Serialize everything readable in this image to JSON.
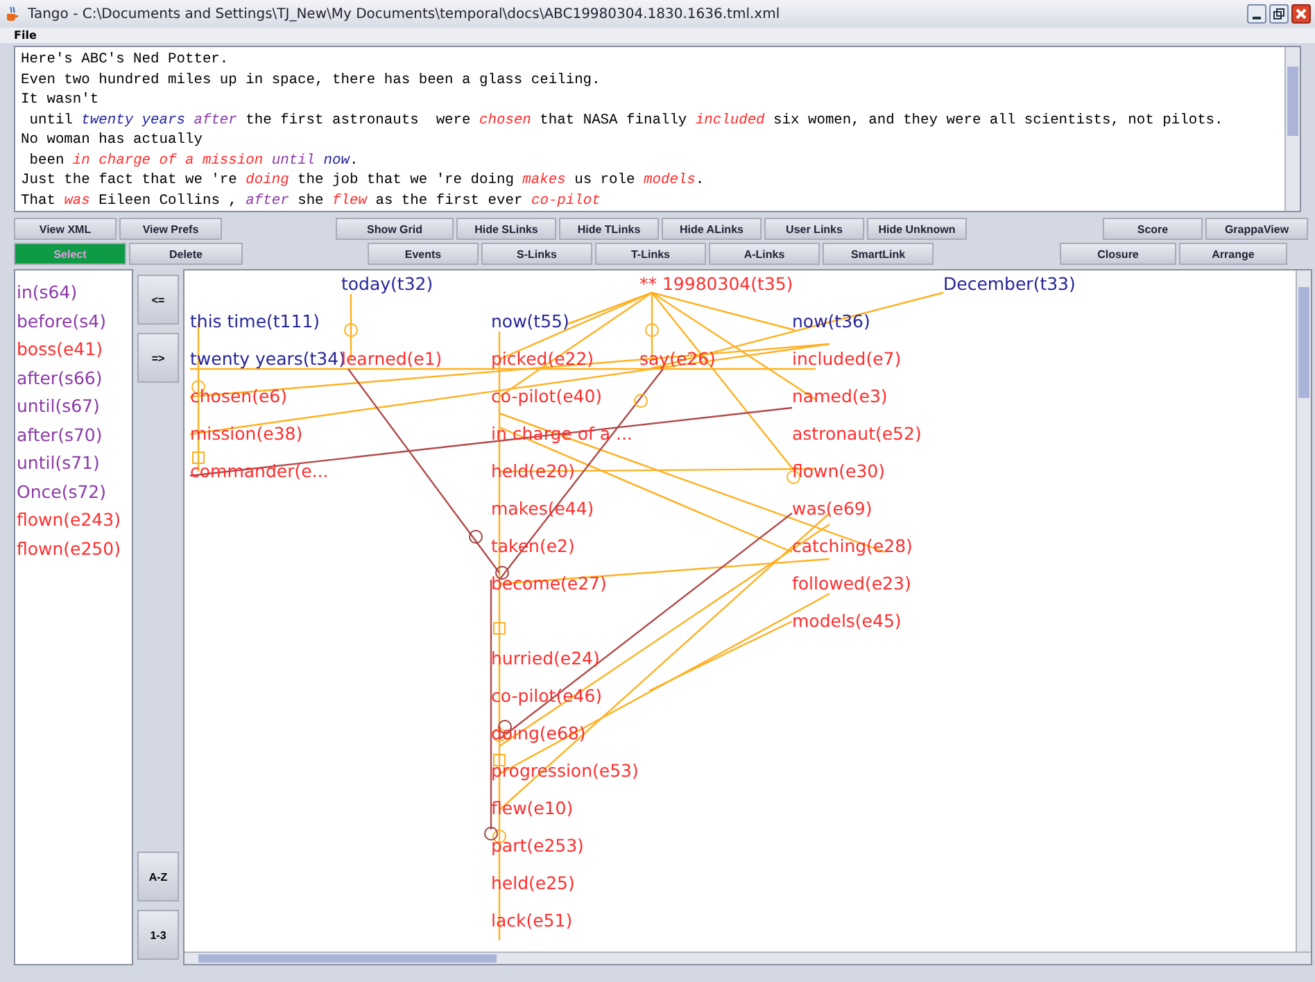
{
  "window": {
    "title": "Tango - C:\\Documents and Settings\\TJ_New\\My Documents\\temporal\\docs\\ABC19980304.1830.1636.tml.xml"
  },
  "menu": [
    "File"
  ],
  "document_lines": [
    [
      {
        "text": "Here's ABC's Ned Potter.",
        "kind": "plain"
      }
    ],
    [
      {
        "text": "Even two hundred miles up in space, there has been a glass ceiling.",
        "kind": "plain"
      }
    ],
    [
      {
        "text": "It wasn't",
        "kind": "plain"
      }
    ],
    [
      {
        "text": " until ",
        "kind": "plain"
      },
      {
        "text": "twenty years ",
        "kind": "timex"
      },
      {
        "text": "after",
        "kind": "signal"
      },
      {
        "text": " the first astronauts  were ",
        "kind": "plain"
      },
      {
        "text": "chosen",
        "kind": "event"
      },
      {
        "text": " that NASA finally ",
        "kind": "plain"
      },
      {
        "text": "included",
        "kind": "event"
      },
      {
        "text": " six women, and they were all scientists, not pilots.",
        "kind": "plain"
      }
    ],
    [
      {
        "text": "No woman has actually",
        "kind": "plain"
      }
    ],
    [
      {
        "text": " been ",
        "kind": "plain"
      },
      {
        "text": "in charge of a mission ",
        "kind": "event"
      },
      {
        "text": "until ",
        "kind": "signal"
      },
      {
        "text": "now",
        "kind": "timex"
      },
      {
        "text": ".",
        "kind": "plain"
      }
    ],
    [
      {
        "text": "Just the fact that we 're ",
        "kind": "plain"
      },
      {
        "text": "doing",
        "kind": "event"
      },
      {
        "text": " the job that we 're doing ",
        "kind": "plain"
      },
      {
        "text": "makes",
        "kind": "event"
      },
      {
        "text": " us role ",
        "kind": "plain"
      },
      {
        "text": "models",
        "kind": "event"
      },
      {
        "text": ".",
        "kind": "plain"
      }
    ],
    [
      {
        "text": "That ",
        "kind": "plain"
      },
      {
        "text": "was",
        "kind": "event"
      },
      {
        "text": " Eileen Collins , ",
        "kind": "plain"
      },
      {
        "text": "after",
        "kind": "signal"
      },
      {
        "text": " she ",
        "kind": "plain"
      },
      {
        "text": "flew",
        "kind": "event"
      },
      {
        "text": " as the first ever ",
        "kind": "plain"
      },
      {
        "text": "co-pilot",
        "kind": "event"
      }
    ]
  ],
  "toolbar_rows": [
    [
      {
        "label": "View XML",
        "selected": false
      },
      {
        "label": "View Prefs",
        "selected": false
      },
      {
        "label": "Show Grid",
        "selected": false
      },
      {
        "label": "Hide SLinks",
        "selected": false
      },
      {
        "label": "Hide TLinks",
        "selected": false
      },
      {
        "label": "Hide ALinks",
        "selected": false
      },
      {
        "label": "User Links",
        "selected": false
      },
      {
        "label": "Hide Unknown",
        "selected": false
      },
      {
        "label": "Score",
        "selected": false
      },
      {
        "label": "GrappaView",
        "selected": false
      }
    ],
    [
      {
        "label": "Select",
        "selected": true
      },
      {
        "label": "Delete",
        "selected": false
      },
      {
        "label": "Events",
        "selected": false
      },
      {
        "label": "S-Links",
        "selected": false
      },
      {
        "label": "T-Links",
        "selected": false
      },
      {
        "label": "A-Links",
        "selected": false
      },
      {
        "label": "SmartLink",
        "selected": false
      },
      {
        "label": "Closure",
        "selected": false
      },
      {
        "label": "Arrange",
        "selected": false
      }
    ]
  ],
  "unplaced": [
    {
      "label": "in(s64)",
      "kind": "signal"
    },
    {
      "label": "before(s4)",
      "kind": "signal"
    },
    {
      "label": "boss(e41)",
      "kind": "event"
    },
    {
      "label": "after(s66)",
      "kind": "signal"
    },
    {
      "label": "until(s67)",
      "kind": "signal"
    },
    {
      "label": "after(s70)",
      "kind": "signal"
    },
    {
      "label": "until(s71)",
      "kind": "signal"
    },
    {
      "label": "Once(s72)",
      "kind": "signal"
    },
    {
      "label": "flown(e243)",
      "kind": "event"
    },
    {
      "label": "flown(e250)",
      "kind": "event"
    }
  ],
  "side_buttons": [
    "<=",
    "=>",
    "A-Z",
    "1-3"
  ],
  "nodes": [
    {
      "label": "today(t32)",
      "kind": "timex"
    },
    {
      "label": "this time(t111)",
      "kind": "timex"
    },
    {
      "label": "twenty years(t34)",
      "kind": "timex"
    },
    {
      "label": "learned(e1)",
      "kind": "event"
    },
    {
      "label": "chosen(e6)",
      "kind": "event"
    },
    {
      "label": "mission(e38)",
      "kind": "event"
    },
    {
      "label": "commander(e...",
      "kind": "event"
    },
    {
      "label": "now(t55)",
      "kind": "timex"
    },
    {
      "label": "picked(e22)",
      "kind": "event"
    },
    {
      "label": "co-pilot(e40)",
      "kind": "event"
    },
    {
      "label": "in charge of a ...",
      "kind": "event"
    },
    {
      "label": "held(e20)",
      "kind": "event"
    },
    {
      "label": "makes(e44)",
      "kind": "event"
    },
    {
      "label": "taken(e2)",
      "kind": "event"
    },
    {
      "label": "become(e27)",
      "kind": "event"
    },
    {
      "label": "hurried(e24)",
      "kind": "event"
    },
    {
      "label": "co-pilot(e46)",
      "kind": "event"
    },
    {
      "label": "doing(e68)",
      "kind": "event"
    },
    {
      "label": "progression(e53)",
      "kind": "event"
    },
    {
      "label": "flew(e10)",
      "kind": "event"
    },
    {
      "label": "part(e253)",
      "kind": "event"
    },
    {
      "label": "held(e25)",
      "kind": "event"
    },
    {
      "label": "lack(e51)",
      "kind": "event"
    },
    {
      "label": "** 19980304(t35)",
      "kind": "event"
    },
    {
      "label": "say(e26)",
      "kind": "event"
    },
    {
      "label": "December(t33)",
      "kind": "timex"
    },
    {
      "label": "now(t36)",
      "kind": "timex"
    },
    {
      "label": "included(e7)",
      "kind": "event"
    },
    {
      "label": "named(e3)",
      "kind": "event"
    },
    {
      "label": "astronaut(e52)",
      "kind": "event"
    },
    {
      "label": "flown(e30)",
      "kind": "event"
    },
    {
      "label": "was(e69)",
      "kind": "event"
    },
    {
      "label": "catching(e28)",
      "kind": "event"
    },
    {
      "label": "followed(e23)",
      "kind": "event"
    },
    {
      "label": "models(e45)",
      "kind": "event"
    }
  ]
}
